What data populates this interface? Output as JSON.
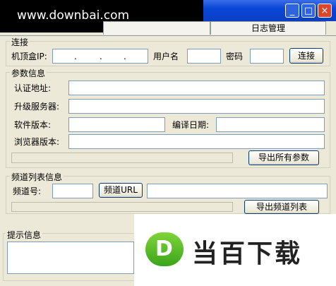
{
  "window": {
    "watermark": "www.downbai.com",
    "minimize": "_",
    "maximize": "□",
    "close": "×"
  },
  "tabs": {
    "second": "日志管理"
  },
  "connect": {
    "group": "连接",
    "ip_label": "机顶盒IP:",
    "ip_dots": [
      ".",
      ".",
      "."
    ],
    "user_label": "用户名",
    "password_label": "密码",
    "connect_button": "连接"
  },
  "params": {
    "group": "参数信息",
    "auth_label": "认证地址:",
    "upgrade_label": "升级服务器:",
    "software_label": "软件版本:",
    "compile_label": "编译日期:",
    "browser_label": "浏览器版本:",
    "export_button": "导出所有参数"
  },
  "channels": {
    "group": "频道列表信息",
    "channel_label": "频道号:",
    "url_button": "频道URL",
    "export_button": "导出频道列表"
  },
  "tips": {
    "group": "提示信息"
  },
  "ad": {
    "logo": "D",
    "text": "当百下载"
  }
}
